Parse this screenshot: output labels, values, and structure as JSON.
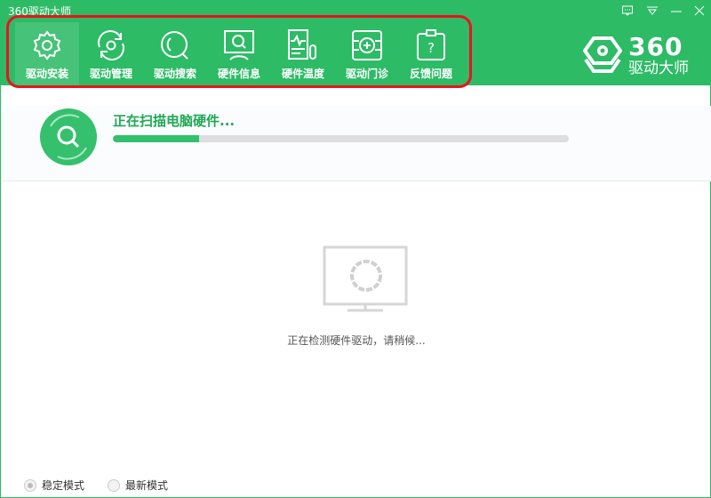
{
  "window": {
    "title": "360驱动大师"
  },
  "window_controls": [
    "feedback-icon",
    "menu-icon",
    "minimize-icon",
    "close-icon"
  ],
  "nav": {
    "items": [
      {
        "label": "驱动安装",
        "icon": "gear-icon",
        "active": true
      },
      {
        "label": "驱动管理",
        "icon": "refresh-icon"
      },
      {
        "label": "驱动搜索",
        "icon": "search-icon"
      },
      {
        "label": "硬件信息",
        "icon": "monitor-search-icon"
      },
      {
        "label": "硬件温度",
        "icon": "thermometer-icon"
      },
      {
        "label": "驱动门诊",
        "icon": "clinic-icon"
      },
      {
        "label": "反馈问题",
        "icon": "clipboard-question-icon"
      }
    ]
  },
  "logo": {
    "number": "360",
    "text": "驱动大师"
  },
  "scan": {
    "title": "正在扫描电脑硬件...",
    "progress_percent": 19
  },
  "status": {
    "text": "正在检测硬件驱动，请稍候..."
  },
  "modes": [
    {
      "label": "稳定模式",
      "selected": true
    },
    {
      "label": "最新模式",
      "selected": false
    }
  ],
  "colors": {
    "brand": "#2dbb66",
    "progress": "#33c06c",
    "annotation": "#e8141e"
  }
}
